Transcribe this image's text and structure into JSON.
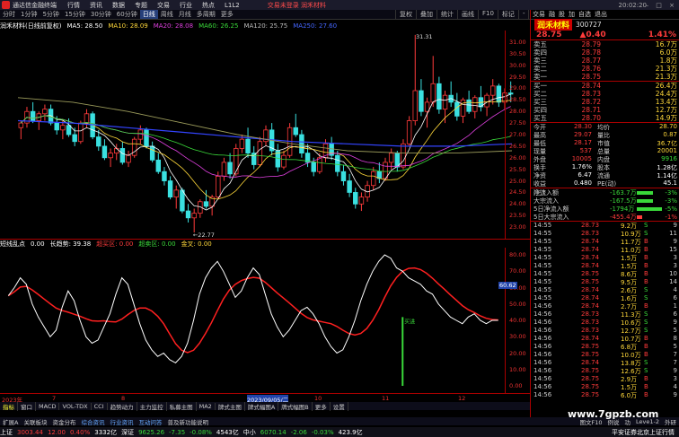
{
  "titlebar": {
    "app_name": "通达信金融终端",
    "menus": [
      "行情",
      "资讯",
      "数据",
      "专题",
      "交易",
      "行业",
      "热点",
      "L1L2"
    ],
    "promo": "交易未登录  润禾材料",
    "time": "20:02:20"
  },
  "toolbar": {
    "periods": [
      "分时",
      "1分钟",
      "5分钟",
      "15分钟",
      "30分钟",
      "60分钟",
      "日线",
      "周线",
      "月线",
      "多周期",
      "更多"
    ],
    "active_period": "日线",
    "right_items": [
      "复权",
      "叠加",
      "统计",
      "画线",
      "F10",
      "标记",
      "-",
      "自选",
      "返回"
    ]
  },
  "chart_header": {
    "stock": "润禾材料(日线前复权)",
    "ma5": "MA5: 28.50",
    "ma10": "MA10: 28.09",
    "ma20": "MA20: 28.08",
    "ma60": "MA60: 26.25",
    "ma120": "MA120: 25.75",
    "ma250": "MA250: 27.60"
  },
  "main_chart": {
    "price_axis": [
      "31.00",
      "30.50",
      "30.00",
      "29.50",
      "29.00",
      "28.50",
      "28.00",
      "27.50",
      "27.00",
      "26.50",
      "26.00",
      "25.50",
      "25.00",
      "24.50",
      "24.00",
      "23.50",
      "23.00"
    ],
    "high_label": "31.31",
    "low_label": "22.77"
  },
  "chart_data": {
    "type": "candlestick",
    "candles": [
      [
        27.3,
        27.6,
        26.8,
        27.5
      ],
      [
        27.5,
        28.2,
        27.3,
        28.0
      ],
      [
        28.0,
        28.4,
        27.5,
        27.6
      ],
      [
        27.6,
        28.0,
        27.2,
        27.9
      ],
      [
        27.9,
        28.3,
        27.6,
        28.1
      ],
      [
        28.1,
        28.3,
        27.4,
        27.5
      ],
      [
        27.5,
        27.8,
        27.0,
        27.2
      ],
      [
        27.2,
        27.6,
        26.8,
        27.4
      ],
      [
        27.4,
        27.7,
        26.9,
        27.0
      ],
      [
        27.0,
        27.3,
        26.5,
        26.7
      ],
      [
        26.7,
        27.6,
        26.6,
        27.5
      ],
      [
        27.5,
        28.1,
        27.3,
        27.9
      ],
      [
        27.9,
        28.0,
        26.8,
        26.9
      ],
      [
        26.9,
        27.2,
        26.3,
        26.5
      ],
      [
        26.5,
        26.8,
        25.9,
        26.0
      ],
      [
        26.0,
        26.4,
        25.6,
        26.2
      ],
      [
        26.2,
        26.6,
        25.9,
        26.4
      ],
      [
        26.4,
        26.7,
        25.7,
        25.8
      ],
      [
        25.8,
        26.3,
        25.6,
        26.1
      ],
      [
        26.1,
        26.9,
        26.0,
        26.8
      ],
      [
        26.8,
        27.4,
        26.6,
        27.2
      ],
      [
        27.2,
        27.3,
        26.4,
        26.5
      ],
      [
        26.5,
        26.7,
        25.8,
        25.9
      ],
      [
        25.9,
        26.2,
        25.3,
        25.4
      ],
      [
        25.4,
        25.6,
        24.8,
        25.0
      ],
      [
        25.0,
        25.2,
        24.2,
        24.3
      ],
      [
        24.3,
        24.8,
        23.8,
        24.6
      ],
      [
        24.6,
        24.7,
        23.6,
        23.7
      ],
      [
        23.7,
        24.0,
        23.2,
        23.4
      ],
      [
        23.4,
        23.8,
        22.77,
        23.6
      ],
      [
        23.6,
        24.2,
        23.4,
        24.1
      ],
      [
        24.1,
        24.6,
        23.8,
        23.9
      ],
      [
        23.9,
        24.4,
        23.5,
        24.3
      ],
      [
        24.3,
        25.4,
        24.2,
        25.2
      ],
      [
        25.2,
        26.0,
        25.0,
        25.8
      ],
      [
        25.8,
        26.2,
        25.1,
        25.3
      ],
      [
        25.3,
        26.6,
        25.2,
        26.4
      ],
      [
        26.4,
        27.0,
        26.2,
        26.8
      ],
      [
        26.8,
        27.3,
        26.0,
        26.2
      ],
      [
        26.2,
        26.5,
        25.5,
        25.7
      ],
      [
        25.7,
        26.9,
        25.6,
        26.7
      ],
      [
        26.7,
        27.4,
        26.5,
        27.2
      ],
      [
        27.2,
        27.5,
        26.1,
        26.3
      ],
      [
        26.3,
        26.6,
        25.4,
        25.6
      ],
      [
        25.6,
        26.3,
        25.5,
        26.1
      ],
      [
        26.1,
        27.5,
        26.0,
        27.3
      ],
      [
        27.3,
        27.9,
        26.9,
        27.0
      ],
      [
        27.0,
        27.2,
        26.0,
        26.2
      ],
      [
        26.2,
        26.6,
        25.6,
        25.8
      ],
      [
        25.8,
        26.0,
        25.2,
        25.4
      ],
      [
        25.4,
        26.2,
        25.3,
        26.0
      ],
      [
        26.0,
        26.8,
        25.8,
        26.6
      ],
      [
        26.6,
        26.9,
        25.9,
        26.1
      ],
      [
        26.1,
        26.3,
        25.2,
        25.4
      ],
      [
        25.4,
        25.7,
        24.8,
        25.0
      ],
      [
        25.0,
        25.3,
        24.3,
        24.5
      ],
      [
        24.5,
        24.7,
        23.8,
        24.0
      ],
      [
        24.0,
        24.5,
        23.7,
        24.3
      ],
      [
        24.3,
        25.0,
        24.1,
        24.8
      ],
      [
        24.8,
        25.6,
        24.6,
        25.4
      ],
      [
        25.4,
        25.8,
        24.9,
        25.1
      ],
      [
        25.1,
        26.0,
        25.0,
        25.8
      ],
      [
        25.8,
        26.4,
        25.5,
        26.2
      ],
      [
        26.2,
        26.3,
        25.4,
        25.6
      ],
      [
        25.6,
        26.8,
        25.5,
        26.6
      ],
      [
        26.6,
        27.8,
        26.5,
        27.6
      ],
      [
        27.6,
        31.31,
        27.4,
        28.9
      ],
      [
        28.9,
        29.4,
        27.8,
        28.0
      ],
      [
        28.0,
        28.6,
        27.3,
        28.4
      ],
      [
        28.4,
        30.4,
        28.2,
        29.2
      ],
      [
        29.2,
        29.5,
        27.9,
        28.1
      ],
      [
        28.1,
        28.9,
        27.5,
        28.7
      ],
      [
        28.7,
        29.3,
        28.2,
        28.4
      ],
      [
        28.4,
        28.8,
        27.6,
        27.8
      ],
      [
        27.8,
        28.6,
        27.5,
        28.5
      ],
      [
        28.5,
        28.9,
        27.9,
        28.0
      ],
      [
        28.0,
        28.7,
        27.7,
        28.6
      ],
      [
        28.6,
        29.1,
        28.0,
        28.2
      ],
      [
        28.2,
        28.8,
        27.8,
        28.7
      ],
      [
        28.7,
        29.4,
        28.3,
        29.1
      ],
      [
        29.1,
        29.2,
        28.2,
        28.4
      ],
      [
        28.4,
        29.0,
        28.1,
        28.8
      ],
      [
        28.8,
        29.3,
        28.4,
        28.75
      ]
    ],
    "ylim": [
      22.5,
      31.5
    ]
  },
  "sub_header": {
    "name": "短线乱点",
    "v1": "0.00",
    "v2": "长趋势: 39.38",
    "v3": "超买区: 0.00",
    "v4": "超卖区: 0.00",
    "v5": "金叉: 0.00"
  },
  "sub_chart": {
    "axis": [
      "80.00",
      "70.00",
      "60.00",
      "50.00",
      "40.00",
      "30.00",
      "20.00",
      "10.00",
      "0.00"
    ],
    "current_value": "60.62",
    "signal_label": "买进"
  },
  "date_axis": [
    "2023年",
    "7",
    "8",
    "2023/09/05/二",
    "10",
    "11",
    "12"
  ],
  "indicator_tabs": [
    "指标",
    "窗口",
    "MACD",
    "VOL-TDX",
    "CCI",
    "趋势动力",
    "主力监控",
    "私募主图",
    "MA2",
    "牌式主图",
    "牌式幅图A",
    "牌式幅图B",
    "更多",
    "设置"
  ],
  "bottom_tabs": [
    "扩展A",
    "关联板块",
    "资金分布",
    "综合资讯",
    "行业资讯",
    "互动问答",
    "普及新功能说明",
    "图文F10",
    "例说",
    "功",
    "Leve1-2",
    "外研"
  ],
  "indexbar": [
    {
      "name": "上证",
      "val": "3003.44",
      "chg": "12.00",
      "pct": "0.40%",
      "amt": "3332亿"
    },
    {
      "name": "深证",
      "val": "9625.26",
      "chg": "-7.35",
      "pct": "-0.08%",
      "amt": "4543亿"
    },
    {
      "name": "中小",
      "val": "6070.14",
      "chg": "-2.06",
      "pct": "-0.03%",
      "amt": "423.9亿"
    }
  ],
  "indexbar_tail": "平安证券北京上证行情",
  "right_panel": {
    "top_items": [
      "交易",
      "融",
      "股",
      "加",
      "自选",
      "退出"
    ],
    "stock_name": "润禾材料",
    "stock_code": "300727",
    "price": "28.75",
    "change": "▲0.40",
    "change_pct": "1.41%",
    "asks": [
      {
        "label": "卖五",
        "price": "28.79",
        "vol": "16.7万"
      },
      {
        "label": "卖四",
        "price": "28.78",
        "vol": "6.0万"
      },
      {
        "label": "卖三",
        "price": "28.77",
        "vol": "1.8万"
      },
      {
        "label": "卖二",
        "price": "28.76",
        "vol": "21.3万"
      },
      {
        "label": "卖一",
        "price": "28.75",
        "vol": "21.3万"
      }
    ],
    "bids": [
      {
        "label": "买一",
        "price": "28.74",
        "vol": "26.4万"
      },
      {
        "label": "买二",
        "price": "28.73",
        "vol": "24.4万"
      },
      {
        "label": "买三",
        "price": "28.72",
        "vol": "13.4万"
      },
      {
        "label": "买四",
        "price": "28.71",
        "vol": "12.7万"
      },
      {
        "label": "买五",
        "price": "28.70",
        "vol": "14.9万"
      }
    ],
    "stats": [
      {
        "a": "今开",
        "av": "28.30",
        "b": "均价",
        "bv": "28.70"
      },
      {
        "a": "最高",
        "av": "29.07",
        "b": "量比",
        "bv": "0.87"
      },
      {
        "a": "最低",
        "av": "28.17",
        "b": "市值",
        "bv": "36.7亿"
      },
      {
        "a": "现量",
        "av": "537",
        "b": "总量",
        "bv": "20001"
      },
      {
        "a": "外盘",
        "av": "10005",
        "b": "内盘",
        "bv": "9916"
      },
      {
        "a": "换手",
        "av": "1.76%",
        "b": "股本",
        "bv": "1.28亿"
      },
      {
        "a": "净资",
        "av": "6.47",
        "b": "流通",
        "bv": "1.14亿"
      },
      {
        "a": "收益(三)",
        "av": "0.480",
        "b": "PE(动)",
        "bv": "45.1"
      }
    ],
    "flows": [
      {
        "label": "净流入额",
        "val": "-163.7万",
        "pct": "-3%",
        "color": "#3ad93a"
      },
      {
        "label": "大宗流入",
        "val": "-167.5万",
        "pct": "-3%",
        "color": "#3ad93a"
      },
      {
        "label": "5日净流入额",
        "val": "-1794万",
        "pct": "-5%",
        "color": "#3ad93a"
      },
      {
        "label": "5日大宗流入",
        "val": "-455.4万",
        "pct": "-1%",
        "color": "#ff3b3b"
      }
    ],
    "ticks": [
      {
        "t": "14:55",
        "p": "28.73",
        "v": "9.2万",
        "s": "S",
        "n": "9"
      },
      {
        "t": "14:55",
        "p": "28.73",
        "v": "10.9万",
        "s": "S",
        "n": "11"
      },
      {
        "t": "14:55",
        "p": "28.74",
        "v": "11.7万",
        "s": "B",
        "n": "9"
      },
      {
        "t": "14:55",
        "p": "28.74",
        "v": "11.0万",
        "s": "B",
        "n": "15"
      },
      {
        "t": "14:55",
        "p": "28.74",
        "v": "1.5万",
        "s": "B",
        "n": "3"
      },
      {
        "t": "14:55",
        "p": "28.74",
        "v": "1.5万",
        "s": "B",
        "n": "3"
      },
      {
        "t": "14:55",
        "p": "28.75",
        "v": "8.6万",
        "s": "B",
        "n": "10"
      },
      {
        "t": "14:55",
        "p": "28.75",
        "v": "9.5万",
        "s": "B",
        "n": "14"
      },
      {
        "t": "14:55",
        "p": "28.74",
        "v": "2.6万",
        "s": "S",
        "n": "4"
      },
      {
        "t": "14:55",
        "p": "28.74",
        "v": "1.6万",
        "s": "S",
        "n": "6"
      },
      {
        "t": "14:56",
        "p": "28.74",
        "v": "2.7万",
        "s": "B",
        "n": "1"
      },
      {
        "t": "14:56",
        "p": "28.73",
        "v": "11.3万",
        "s": "S",
        "n": "6"
      },
      {
        "t": "14:56",
        "p": "28.73",
        "v": "10.6万",
        "s": "S",
        "n": "9"
      },
      {
        "t": "14:56",
        "p": "28.73",
        "v": "12.7万",
        "s": "S",
        "n": "5"
      },
      {
        "t": "14:56",
        "p": "28.74",
        "v": "10.7万",
        "s": "B",
        "n": "8"
      },
      {
        "t": "14:56",
        "p": "28.75",
        "v": "6.8万",
        "s": "B",
        "n": "5"
      },
      {
        "t": "14:56",
        "p": "28.75",
        "v": "10.0万",
        "s": "B",
        "n": "7"
      },
      {
        "t": "14:56",
        "p": "28.74",
        "v": "13.8万",
        "s": "S",
        "n": "7"
      },
      {
        "t": "14:56",
        "p": "28.75",
        "v": "12.6万",
        "s": "S",
        "n": "9"
      },
      {
        "t": "14:56",
        "p": "28.75",
        "v": "2.9万",
        "s": "B",
        "n": "3"
      },
      {
        "t": "14:56",
        "p": "28.75",
        "v": "1.5万",
        "s": "B",
        "n": "4"
      },
      {
        "t": "14:56",
        "p": "28.75",
        "v": "6.0万",
        "s": "B",
        "n": "9"
      }
    ]
  },
  "watermark": "www.7gpzb.com"
}
